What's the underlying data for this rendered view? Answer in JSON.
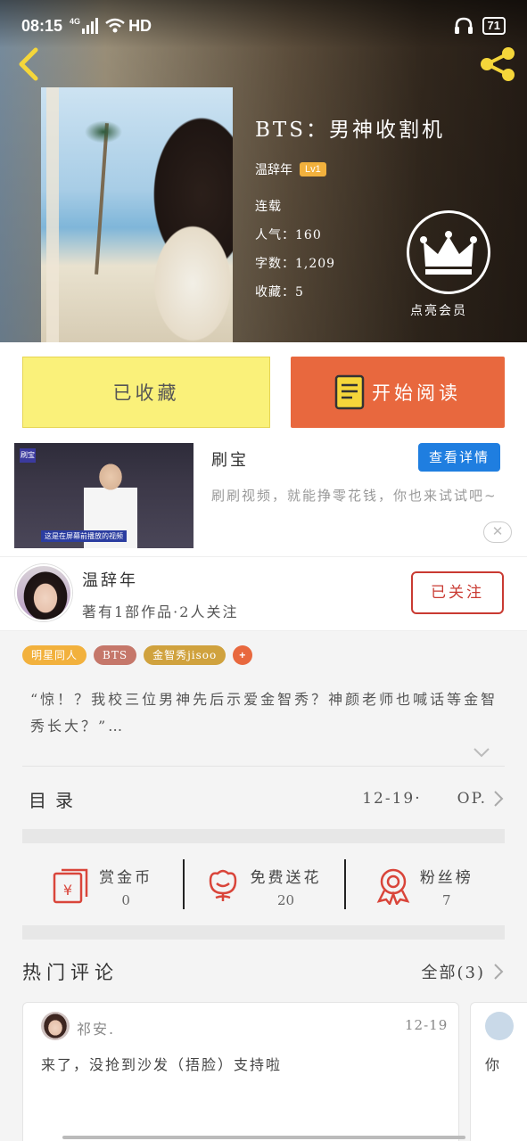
{
  "status_bar": {
    "time": "08:15",
    "net": "4G",
    "hd": "HD",
    "battery": "71"
  },
  "book": {
    "title": "BTS：男神收割机",
    "author": "温辞年",
    "level": "Lv1",
    "status": "连载",
    "popularity": "人气：160",
    "word_count": "字数：1,209",
    "favorites": "收藏：5"
  },
  "vip": {
    "label": "点亮会员"
  },
  "actions": {
    "fav_label": "已收藏",
    "read_label": "开始阅读"
  },
  "ad": {
    "name": "刷宝",
    "detail_label": "查看详情",
    "description": "刷刷视频，就能挣零花钱，你也来试试吧~",
    "thumb_logo": "刷宝",
    "thumb_caption": "这是在屏幕前播放的视频",
    "close_label": "✕"
  },
  "author_section": {
    "name": "温辞年",
    "stats": "著有1部作品·2人关注",
    "follow_label": "已关注"
  },
  "tags": [
    "明星同人",
    "BTS",
    "金智秀jisoo",
    "+"
  ],
  "description": "“惊！？我校三位男神先后示爱金智秀？神颜老师也喊话等金智秀长大？”…",
  "toc": {
    "label": "目录",
    "date": "12-19·",
    "op": "OP."
  },
  "rewards": [
    {
      "label": "赏金币",
      "value": "0",
      "icon": "red-envelope-icon"
    },
    {
      "label": "免费送花",
      "value": "20",
      "icon": "flower-icon"
    },
    {
      "label": "粉丝榜",
      "value": "7",
      "icon": "medal-icon"
    }
  ],
  "hot_comments": {
    "title": "热门评论",
    "all_label": "全部(3)",
    "items": [
      {
        "user": "祁安.",
        "date": "12-19",
        "text": "来了，没抢到沙发（捂脸）支持啦"
      }
    ],
    "peek_text": "你"
  },
  "colors": {
    "fav_bg": "#faf17a",
    "read_bg": "#e8683e",
    "follow": "#c93a32",
    "detail_blue": "#1f7ee0",
    "level": "#f2b13d"
  }
}
